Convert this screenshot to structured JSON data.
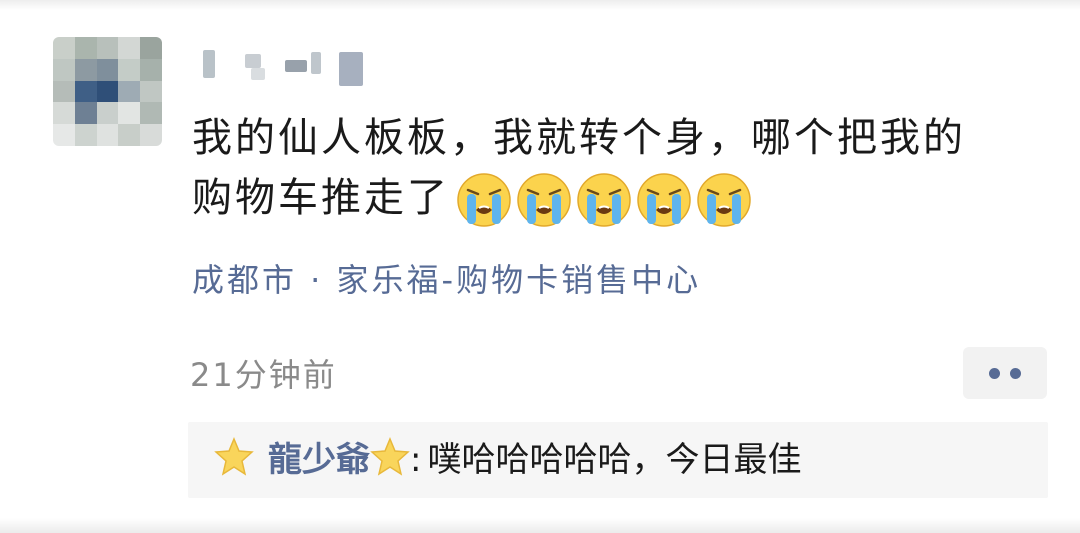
{
  "post": {
    "author_name_obscured": true,
    "text_line1": "我的仙人板板，我就转个身，哪个把我的",
    "text_line2": "购物车推走了",
    "emoji_icon": "loudly-crying-face-icon",
    "emoji_count": 5,
    "location": "成都市 · 家乐福-购物卡销售中心",
    "time": "21分钟前"
  },
  "actions": {
    "more_icon": "more-dots-icon"
  },
  "comment": {
    "author": "龍少爺",
    "author_decoration_icon": "star-icon",
    "separator": ":",
    "text": "噗哈哈哈哈哈，今日最佳"
  },
  "colors": {
    "link": "#576b95",
    "text": "#1a1a1a",
    "muted": "#8a8a8a",
    "comment_bg": "#f6f6f6",
    "more_bg": "#f2f2f2"
  }
}
